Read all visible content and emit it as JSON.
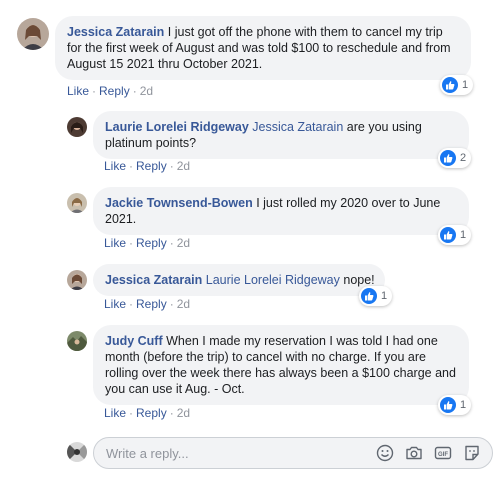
{
  "comments": [
    {
      "author": "Jessica Zatarain",
      "mention": "",
      "text": "I just got off the phone with them to cancel my trip for the first week of August and was told $100 to reschedule and from August 15 2021 thru October 2021.",
      "like": "Like",
      "reply": "Reply",
      "time": "2d",
      "reaction_count": "1"
    },
    {
      "author": "Laurie Lorelei Ridgeway",
      "mention": "Jessica Zatarain",
      "text": "are you using platinum points?",
      "like": "Like",
      "reply": "Reply",
      "time": "2d",
      "reaction_count": "2"
    },
    {
      "author": "Jackie Townsend-Bowen",
      "mention": "",
      "text": "I just rolled my 2020 over to June 2021.",
      "like": "Like",
      "reply": "Reply",
      "time": "2d",
      "reaction_count": "1"
    },
    {
      "author": "Jessica Zatarain",
      "mention": "Laurie Lorelei Ridgeway",
      "text": "nope!",
      "like": "Like",
      "reply": "Reply",
      "time": "2d",
      "reaction_count": "1"
    },
    {
      "author": "Judy Cuff",
      "mention": "",
      "text": "When I made my reservation I was told I had one month (before the trip) to cancel with no charge. If you are rolling over the week there has always been a $100 charge and you can use it Aug. - Oct.",
      "like": "Like",
      "reply": "Reply",
      "time": "2d",
      "reaction_count": "1"
    }
  ],
  "reply_box": {
    "placeholder": "Write a reply...",
    "icons": [
      "emoji-icon",
      "camera-icon",
      "gif-icon",
      "sticker-icon"
    ]
  },
  "colors": {
    "link": "#385898",
    "bubble": "#f2f3f5",
    "meta": "#90949c",
    "like_blue": "#1877f2"
  }
}
